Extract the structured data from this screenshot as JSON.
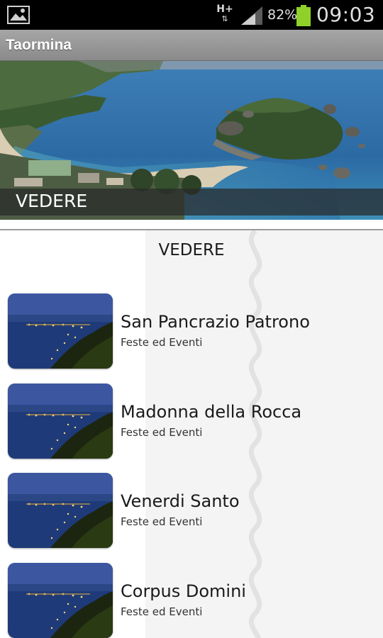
{
  "status_bar": {
    "network_type": "H+",
    "battery_percent": "82%",
    "time": "09:03",
    "battery_color": "#8fd12a",
    "icons": [
      "picture-notification-icon",
      "network-arrows-icon",
      "signal-strength-icon",
      "battery-icon"
    ]
  },
  "app_bar": {
    "title": "Taormina"
  },
  "hero": {
    "caption": "VEDERE"
  },
  "section": {
    "title": "VEDERE"
  },
  "list": {
    "items": [
      {
        "title": "San Pancrazio Patrono",
        "subtitle": "Feste ed Eventi"
      },
      {
        "title": "Madonna della Rocca",
        "subtitle": "Feste ed Eventi"
      },
      {
        "title": "Venerdi Santo",
        "subtitle": "Feste ed Eventi"
      },
      {
        "title": "Corpus Domini",
        "subtitle": "Feste ed Eventi"
      }
    ]
  }
}
